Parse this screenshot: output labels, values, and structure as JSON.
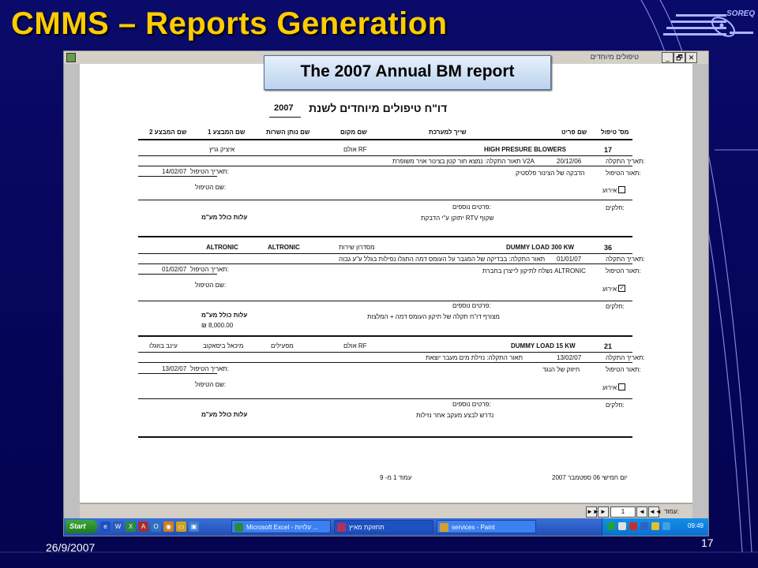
{
  "slide": {
    "title": "CMMS – Reports Generation",
    "logo_text": "SOREQ",
    "date": "26/9/2007",
    "page_number": "17",
    "callout": "The 2007 Annual BM report"
  },
  "window": {
    "title": "טיפולים מיוחדים",
    "buttons": [
      "_",
      "🗗",
      "✕"
    ]
  },
  "report": {
    "heading": "דו\"ח טיפולים מיוחדים לשנת",
    "year": "2007",
    "columns": [
      "מס' טיפול",
      "שם פריט",
      "שייך למערכת",
      "שם מקום",
      "שם נותן השרות",
      "שם המבצע 1",
      "שם המבצע 2"
    ],
    "labels": {
      "open_date": "תאריך התקלה:",
      "fault_desc": "תאור התקלה:",
      "repair_date": "תאריך הטיפול:",
      "repair_desc": "תאור הטיפול:",
      "treater": "שם הטיפול:",
      "event": "אירוע",
      "parts": "חלקים:",
      "details": "פרטים נוספים:",
      "total_cost": "עלות כולל מע\"מ"
    },
    "records": [
      {
        "number": "17",
        "item": "HIGH PRESURE BLOWERS",
        "place": "אולם RF",
        "provider": "",
        "exec1": "איציק גרץ",
        "exec2": "",
        "open_date": "20/12/06",
        "fault_desc": "תאור התקלה: נמצא חור קטן בצינור אויר משופרת V2A",
        "repair_date": "14/02/07",
        "repair_desc": "הדבקה של הצינור פלסטיק",
        "event_checked": false,
        "details": "יתוקן ע\"י הדבקת RTV שקוף",
        "cost": ""
      },
      {
        "number": "36",
        "item": "DUMMY LOAD 300 KW",
        "place": "מסדרון שירות",
        "provider": "ALTRONIC",
        "exec1": "ALTRONIC",
        "exec2": "",
        "open_date": "01/01/07",
        "fault_desc": "תאור התקלה: בבדיקה של המגבר על העומס דמה התגלו נפילות בגלל ע\"ע גבוה",
        "repair_date": "01/02/07",
        "repair_desc": "נשלח לתיקון לייצרן בחברת ALTRONIC",
        "event_checked": true,
        "details": "מצורף דו\"ח תקלה של תיקון העומס דמה + המלצות",
        "cost": "₪ 8,000.00"
      },
      {
        "number": "21",
        "item": "DUMMY LOAD 15 KW",
        "place": "אולם RF",
        "provider": "מפעילים",
        "exec1": "מיכאל ביסאקוב",
        "exec2": "עינב בוזגלו",
        "open_date": "13/02/07",
        "fault_desc": "תאור התקלה: נזילת מים מעבר יוצאת",
        "repair_date": "13/02/07",
        "repair_desc": "חיזוק של הנגד",
        "event_checked": false,
        "details": "נדרש לבצע מעקב אחר נזילות",
        "cost": ""
      }
    ],
    "footer_date": "יום חמישי 06 ספטמבר 2007",
    "footer_page": "עמוד 1 מ- 9"
  },
  "nav": {
    "page_label": "עמוד:",
    "page_value": "1",
    "buttons": [
      "◄◄",
      "◄",
      "►",
      "►►"
    ]
  },
  "taskbar": {
    "start_label": "Start",
    "tasks": [
      {
        "label": "Microsoft Excel - עלויות ...",
        "color": "#2a8a3a",
        "active": false
      },
      {
        "label": "תחזוקת מאיץ",
        "color": "#b03060",
        "active": true
      },
      {
        "label": "services - Paint",
        "color": "#d0a030",
        "active": false
      }
    ],
    "clock": "09:49"
  }
}
